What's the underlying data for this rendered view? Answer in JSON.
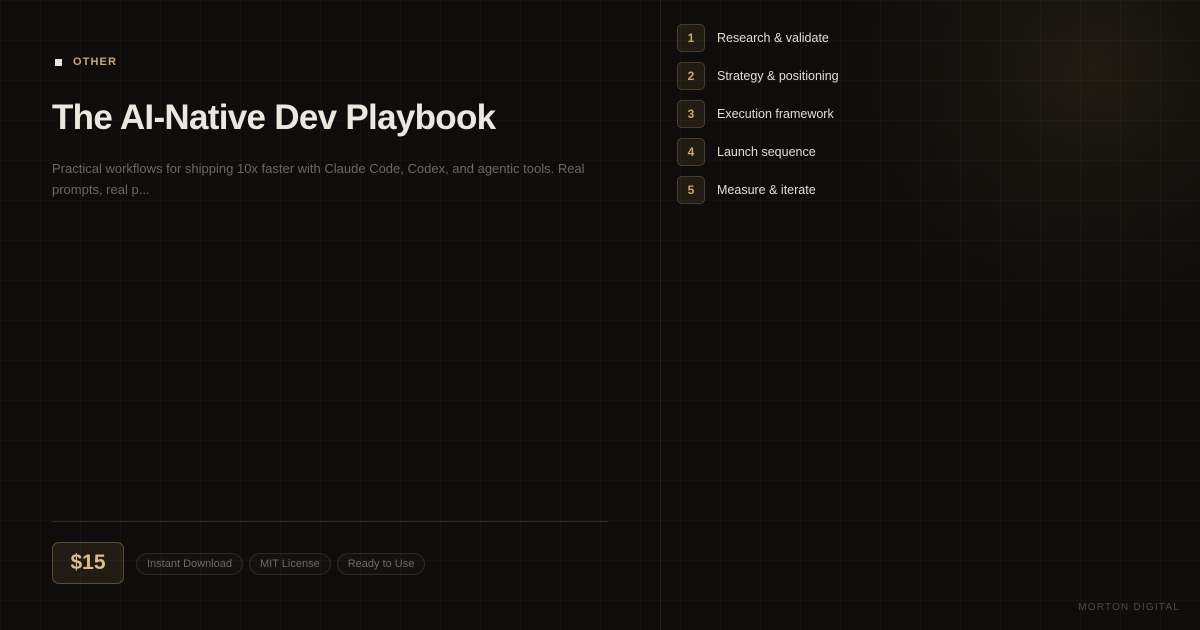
{
  "category": {
    "label": "OTHER",
    "icon": "square-icon"
  },
  "product": {
    "title": "The AI-Native Dev Playbook",
    "description": "Practical workflows for shipping 10x faster with Claude Code, Codex, and agentic tools. Real prompts, real p...",
    "price": "$15"
  },
  "tags": [
    "Instant Download",
    "MIT License",
    "Ready to Use"
  ],
  "steps": [
    {
      "number": "1",
      "label": "Research & validate"
    },
    {
      "number": "2",
      "label": "Strategy & positioning"
    },
    {
      "number": "3",
      "label": "Execution framework"
    },
    {
      "number": "4",
      "label": "Launch sequence"
    },
    {
      "number": "5",
      "label": "Measure & iterate"
    }
  ],
  "brand": "MORTON DIGITAL",
  "colors": {
    "background": "#0e0d0b",
    "accent": "#c9a86f",
    "title": "#ede8df",
    "muted_text": "#6d6860"
  }
}
